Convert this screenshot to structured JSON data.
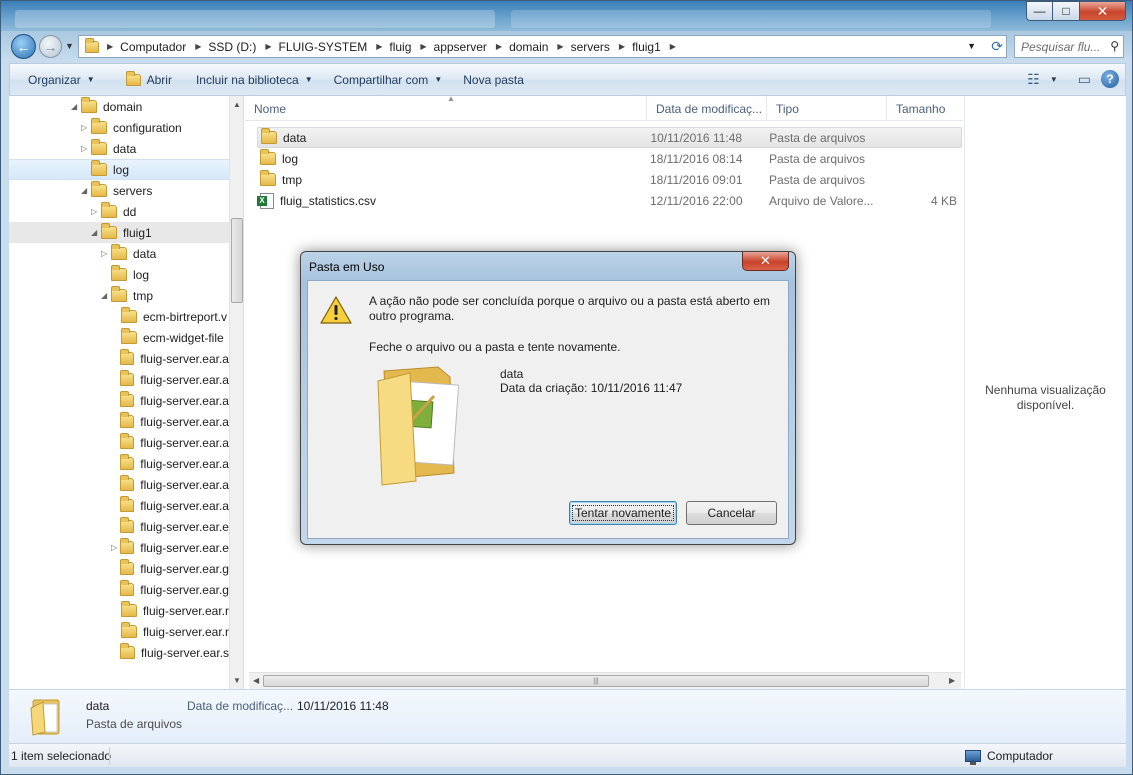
{
  "window": {
    "controls": {
      "minimize": "—",
      "maximize": "□",
      "close": "✕"
    }
  },
  "nav": {
    "back": "←",
    "forward": "→"
  },
  "address": {
    "crumbs": [
      "Computador",
      "SSD (D:)",
      "FLUIG-SYSTEM",
      "fluig",
      "appserver",
      "domain",
      "servers",
      "fluig1"
    ]
  },
  "search": {
    "placeholder": "Pesquisar flu..."
  },
  "toolbar": {
    "organize": "Organizar",
    "open": "Abrir",
    "include_library": "Incluir na biblioteca",
    "share": "Compartilhar com",
    "new_folder": "Nova pasta"
  },
  "tree": {
    "items": [
      {
        "label": "domain",
        "exp": "◢"
      },
      {
        "label": "configuration",
        "exp": "▷"
      },
      {
        "label": "data",
        "exp": "▷"
      },
      {
        "label": "log",
        "exp": ""
      },
      {
        "label": "servers",
        "exp": "◢"
      },
      {
        "label": "dd",
        "exp": "▷"
      },
      {
        "label": "fluig1",
        "exp": "◢"
      },
      {
        "label": "data",
        "exp": "▷"
      },
      {
        "label": "log",
        "exp": ""
      },
      {
        "label": "tmp",
        "exp": "◢"
      },
      {
        "label": "ecm-birtreport.v",
        "exp": ""
      },
      {
        "label": "ecm-widget-file",
        "exp": ""
      },
      {
        "label": "fluig-server.ear.a",
        "exp": ""
      },
      {
        "label": "fluig-server.ear.a",
        "exp": ""
      },
      {
        "label": "fluig-server.ear.a",
        "exp": ""
      },
      {
        "label": "fluig-server.ear.a",
        "exp": ""
      },
      {
        "label": "fluig-server.ear.a",
        "exp": ""
      },
      {
        "label": "fluig-server.ear.a",
        "exp": ""
      },
      {
        "label": "fluig-server.ear.a",
        "exp": ""
      },
      {
        "label": "fluig-server.ear.a",
        "exp": ""
      },
      {
        "label": "fluig-server.ear.e",
        "exp": ""
      },
      {
        "label": "fluig-server.ear.e",
        "exp": "▷"
      },
      {
        "label": "fluig-server.ear.g",
        "exp": ""
      },
      {
        "label": "fluig-server.ear.g",
        "exp": ""
      },
      {
        "label": "fluig-server.ear.r",
        "exp": ""
      },
      {
        "label": "fluig-server.ear.r",
        "exp": ""
      },
      {
        "label": "fluig-server.ear.s",
        "exp": ""
      }
    ]
  },
  "columns": {
    "name": "Nome",
    "date": "Data de modificaç...",
    "type": "Tipo",
    "size": "Tamanho"
  },
  "files": [
    {
      "name": "data",
      "date": "10/11/2016 11:48",
      "type": "Pasta de arquivos",
      "size": ""
    },
    {
      "name": "log",
      "date": "18/11/2016 08:14",
      "type": "Pasta de arquivos",
      "size": ""
    },
    {
      "name": "tmp",
      "date": "18/11/2016 09:01",
      "type": "Pasta de arquivos",
      "size": ""
    },
    {
      "name": "fluig_statistics.csv",
      "date": "12/11/2016 22:00",
      "type": "Arquivo de Valore...",
      "size": "4 KB"
    }
  ],
  "preview": {
    "text": "Nenhuma visualização disponível."
  },
  "details": {
    "name": "data",
    "type": "Pasta de arquivos",
    "modified_label": "Data de modificaç...",
    "modified_value": "10/11/2016 11:48"
  },
  "status": {
    "selected": "1 item selecionado",
    "location": "Computador"
  },
  "dialog": {
    "title": "Pasta em Uso",
    "message": "A ação não pode ser concluída porque o arquivo ou a pasta está aberto em outro programa.",
    "message2": "Feche o arquivo ou a pasta e tente novamente.",
    "file_name": "data",
    "file_date": "Data da criação: 10/11/2016 11:47",
    "retry": "Tentar novamente",
    "cancel": "Cancelar"
  }
}
